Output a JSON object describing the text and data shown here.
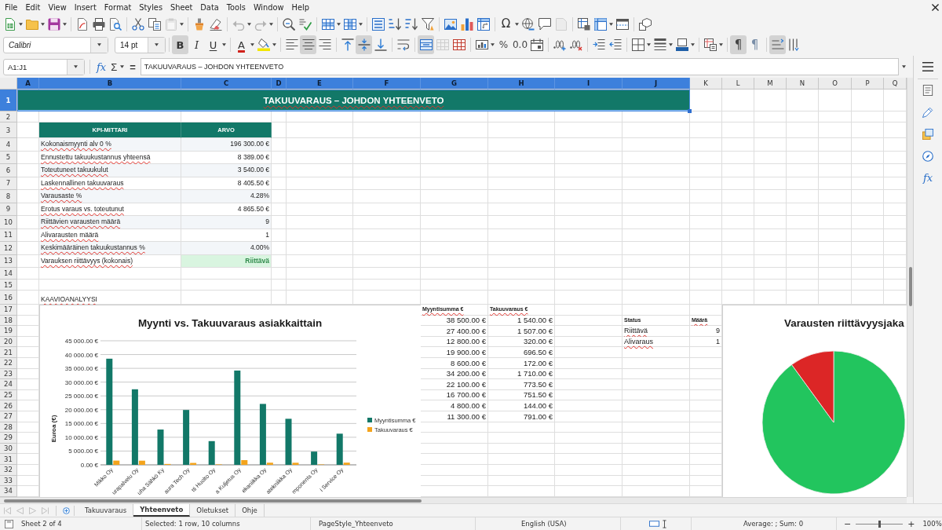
{
  "menu_bar": {
    "items": [
      "File",
      "Edit",
      "View",
      "Insert",
      "Format",
      "Styles",
      "Sheet",
      "Data",
      "Tools",
      "Window",
      "Help"
    ]
  },
  "standard_toolbar": {
    "paste": {
      "disabled": true
    },
    "undo": {
      "disabled": true
    },
    "redo": {
      "disabled": true
    },
    "special_character": {
      "glyph": "Ω"
    },
    "header_footer": {
      "disabled": true
    }
  },
  "formatting_toolbar": {
    "font_name": "Calibri",
    "font_size": "14 pt",
    "bold": {
      "glyph": "B",
      "on": true
    },
    "italic": {
      "glyph": "I",
      "on": false
    },
    "underline": {
      "glyph": "U",
      "on": false
    },
    "font_color": {
      "glyph": "A"
    },
    "align_left": {
      "on": false
    },
    "align_center": {
      "on": true
    },
    "align_right": {
      "on": false
    },
    "align_top": {
      "on": false
    },
    "align_middle": {
      "on": true
    },
    "align_bottom": {
      "on": false
    },
    "wrap_text": {
      "on": false
    },
    "merge_and_center": {
      "on": true
    },
    "merge_cells": {
      "disabled": true
    },
    "percent": {
      "glyph": "%"
    },
    "number_format": {
      "glyph": "0.0"
    },
    "paragraph_ltr": {
      "glyph": "¶",
      "on": true
    },
    "paragraph_rtl": {
      "glyph": "¶",
      "on": false
    },
    "text_direction_ltr": {
      "on": true
    },
    "text_direction_ttb": {
      "on": false
    }
  },
  "formula_bar": {
    "name_box": "A1:J1",
    "function_glyph": "fx",
    "sum_glyph": "Σ",
    "equals_glyph": "=",
    "content": "TAKUUVARAUS – JOHDON YHTEENVETO"
  },
  "sidebar": {
    "functions_glyph": "fx"
  },
  "sheet": {
    "column_headers": [
      {
        "label": "A",
        "selected": true
      },
      {
        "label": "B",
        "selected": true
      },
      {
        "label": "C",
        "selected": true
      },
      {
        "label": "D",
        "selected": true
      },
      {
        "label": "E",
        "selected": true
      },
      {
        "label": "F",
        "selected": true
      },
      {
        "label": "G",
        "selected": true
      },
      {
        "label": "H",
        "selected": true
      },
      {
        "label": "I",
        "selected": true
      },
      {
        "label": "J",
        "selected": true
      },
      {
        "label": "K",
        "selected": false
      },
      {
        "label": "L",
        "selected": false
      },
      {
        "label": "M",
        "selected": false
      },
      {
        "label": "N",
        "selected": false
      },
      {
        "label": "O",
        "selected": false
      },
      {
        "label": "P",
        "selected": false
      },
      {
        "label": "Q",
        "selected": false
      }
    ],
    "row_headers": [
      {
        "label": "1",
        "selected": true
      },
      {
        "label": "2",
        "selected": false
      },
      {
        "label": "3",
        "selected": false
      },
      {
        "label": "4",
        "selected": false
      },
      {
        "label": "5",
        "selected": false
      },
      {
        "label": "6",
        "selected": false
      },
      {
        "label": "7",
        "selected": false
      },
      {
        "label": "8",
        "selected": false
      },
      {
        "label": "9",
        "selected": false
      },
      {
        "label": "10",
        "selected": false
      },
      {
        "label": "11",
        "selected": false
      },
      {
        "label": "12",
        "selected": false
      },
      {
        "label": "13",
        "selected": false
      },
      {
        "label": "14",
        "selected": false
      },
      {
        "label": "15",
        "selected": false
      },
      {
        "label": "16",
        "selected": false
      },
      {
        "label": "17",
        "selected": false
      },
      {
        "label": "18",
        "selected": false
      },
      {
        "label": "19",
        "selected": false
      },
      {
        "label": "20",
        "selected": false
      },
      {
        "label": "21",
        "selected": false
      },
      {
        "label": "22",
        "selected": false
      },
      {
        "label": "23",
        "selected": false
      },
      {
        "label": "24",
        "selected": false
      },
      {
        "label": "25",
        "selected": false
      },
      {
        "label": "26",
        "selected": false
      },
      {
        "label": "27",
        "selected": false
      },
      {
        "label": "28",
        "selected": false
      },
      {
        "label": "29",
        "selected": false
      },
      {
        "label": "30",
        "selected": false
      },
      {
        "label": "31",
        "selected": false
      },
      {
        "label": "32",
        "selected": false
      },
      {
        "label": "33",
        "selected": false
      },
      {
        "label": "34",
        "selected": false
      }
    ],
    "title_cell": {
      "text": "TAKUUVARAUS – JOHDON YHTEENVETO",
      "selected": true,
      "spelling_error": true
    },
    "kpi_table": {
      "headers": [
        "KPI-MITTARI",
        "ARVO"
      ],
      "rows": [
        {
          "label": "Kokonaismyynti alv 0 %",
          "value": "196 300.00 €",
          "kind": "value",
          "spelling_error": true
        },
        {
          "label": "Ennustettu takuukustannus yhteensä",
          "value": "8 389.00 €",
          "kind": "value",
          "spelling_error": true
        },
        {
          "label": "Toteutuneet takuukulut",
          "value": "3 540.00 €",
          "kind": "value",
          "spelling_error": true
        },
        {
          "label": "Laskennallinen takuuvaraus",
          "value": "8 405.50 €",
          "kind": "value",
          "spelling_error": true
        },
        {
          "label": "Varausaste %",
          "value": "4.28%",
          "kind": "value",
          "spelling_error": true
        },
        {
          "label": "Erotus varaus vs. toteutunut",
          "value": "4 865.50 €",
          "kind": "value",
          "spelling_error": true
        },
        {
          "label": "Riittävien varausten määrä",
          "value": "9",
          "kind": "value",
          "spelling_error": true
        },
        {
          "label": "Alivarausten määrä",
          "value": "1",
          "kind": "value",
          "spelling_error": true
        },
        {
          "label": "Keskimääräinen takuukustannus %",
          "value": "4.00%",
          "kind": "value",
          "spelling_error": true
        },
        {
          "label": "Varauksen riittävyys (kokonais)",
          "value": "Riittävä",
          "kind": "status",
          "spelling_error": true
        }
      ]
    },
    "section_label": {
      "text": "KAAVIOANALYYSI",
      "spelling_error": true
    },
    "sales_table": {
      "headers": [
        {
          "text": "Myyntisumma €",
          "spelling_error": true
        },
        {
          "text": "Takuuvaraus €",
          "spelling_error": true
        }
      ],
      "rows": [
        [
          "38 500.00 €",
          "1 540.00 €"
        ],
        [
          "27 400.00 €",
          "1 507.00 €"
        ],
        [
          "12 800.00 €",
          "320.00 €"
        ],
        [
          "19 900.00 €",
          "696.50 €"
        ],
        [
          "8 600.00 €",
          "172.00 €"
        ],
        [
          "34 200.00 €",
          "1 710.00 €"
        ],
        [
          "22 100.00 €",
          "773.50 €"
        ],
        [
          "16 700.00 €",
          "751.50 €"
        ],
        [
          "4 800.00 €",
          "144.00 €"
        ],
        [
          "11 300.00 €",
          "791.00 €"
        ]
      ]
    },
    "status_table": {
      "headers": [
        {
          "text": "Status",
          "spelling_error": false
        },
        {
          "text": "Määrä",
          "spelling_error": true
        }
      ],
      "rows": [
        {
          "status": "Riittävä",
          "count": "9",
          "spelling_error": true
        },
        {
          "status": "Alivaraus",
          "count": "1",
          "spelling_error": true
        }
      ]
    },
    "bar_chart": {
      "chart_data": {
        "type": "bar",
        "title": "Myynti vs. Takuuvaraus asiakkaittain",
        "ylabel": "Euroa (€)",
        "categories": [
          "Mikko Oy",
          "urapalvelu Oy",
          "uha Sähkö Ky",
          "aura Tech Oy",
          "tti Huolto Oy",
          "a Kuljetus Oy",
          "ekaniikka Oy",
          "atekniikka Oy",
          "mponents Oy",
          "i Service Oy"
        ],
        "series": [
          {
            "name": "Myyntisumma €",
            "color": "#127868",
            "values": [
              38500,
              27400,
              12800,
              19900,
              8600,
              34200,
              22100,
              16700,
              4800,
              11300
            ]
          },
          {
            "name": "Takuuvaraus €",
            "color": "#f4a41c",
            "values": [
              1540,
              1507,
              320,
              696.5,
              172,
              1710,
              773.5,
              751.5,
              144,
              791
            ]
          }
        ],
        "ylim": [
          0,
          45000
        ],
        "yticks": [
          {
            "value": 0,
            "label": "0.00 €"
          },
          {
            "value": 5000,
            "label": "5 000.00 €"
          },
          {
            "value": 10000,
            "label": "10 000.00 €"
          },
          {
            "value": 15000,
            "label": "15 000.00 €"
          },
          {
            "value": 20000,
            "label": "20 000.00 €"
          },
          {
            "value": 25000,
            "label": "25 000.00 €"
          },
          {
            "value": 30000,
            "label": "30 000.00 €"
          },
          {
            "value": 35000,
            "label": "35 000.00 €"
          },
          {
            "value": 40000,
            "label": "40 000.00 €"
          },
          {
            "value": 45000,
            "label": "45 000.00 €"
          }
        ],
        "grid": true,
        "legend": "right"
      }
    },
    "pie_chart": {
      "chart_data": {
        "type": "pie",
        "title": "Varausten riittävyysjaka",
        "values": [
          90,
          10
        ],
        "colors": [
          "#22c55e",
          "#dc2626"
        ]
      }
    }
  },
  "sheet_tabs": {
    "scroll_buttons_disabled": true,
    "tabs": [
      {
        "label": "Takuuvaraus",
        "selected": false
      },
      {
        "label": "Yhteenveto",
        "selected": true
      },
      {
        "label": "Oletukset",
        "selected": false
      },
      {
        "label": "Ohje",
        "selected": false
      }
    ]
  },
  "status_bar": {
    "sheet": "Sheet 2 of 4",
    "selection": "Selected: 1 row, 10 columns",
    "page_style": "PageStyle_Yhteenveto",
    "language": "English (USA)",
    "summary": "Average: ; Sum: 0",
    "zoom_out": "−",
    "zoom_in": "+",
    "zoom": {
      "level": 0.5
    },
    "zoom_percent": "100%"
  }
}
